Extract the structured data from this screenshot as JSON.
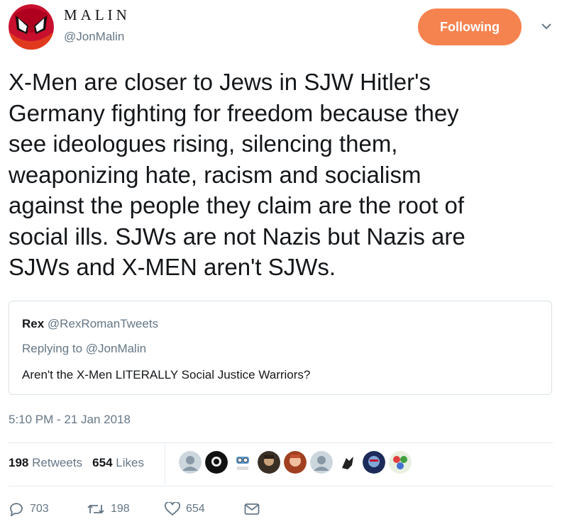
{
  "user": {
    "display_name": "MALIN",
    "handle": "@JonMalin"
  },
  "follow_button": {
    "label": "Following",
    "color": "#f5834f"
  },
  "tweet": {
    "lines": [
      "X-Men are closer to Jews in SJW Hitler's",
      "Germany fighting for freedom because they",
      "see ideologues rising, silencing them,",
      "weaponizing hate, racism and socialism",
      "against the people they claim are the root of",
      "social ills. SJWs are not Nazis but Nazis are",
      "SJWs and X-MEN aren't SJWs."
    ]
  },
  "quoted": {
    "name": "Rex",
    "handle": "@RexRomanTweets",
    "replying_to": "Replying to @JonMalin",
    "text": "Aren't the X-Men LITERALLY Social Justice Warriors?"
  },
  "timestamp": "5:10 PM - 21 Jan 2018",
  "stats": {
    "retweets_count": "198",
    "retweets_label": "Retweets",
    "likes_count": "654",
    "likes_label": "Likes"
  },
  "actions": {
    "reply_count": "703",
    "retweet_count": "198",
    "like_count": "654"
  }
}
